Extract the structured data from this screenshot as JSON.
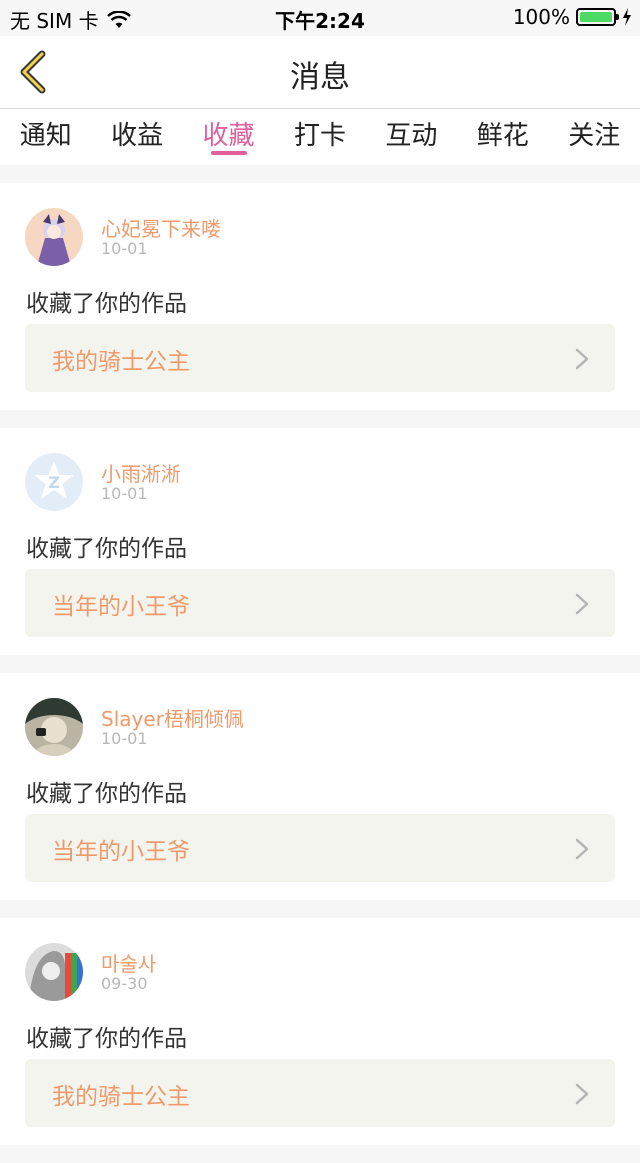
{
  "status": {
    "carrier": "无 SIM 卡",
    "time": "下午2:24",
    "battery": "100%"
  },
  "nav": {
    "title": "消息"
  },
  "tabs": [
    {
      "label": "通知"
    },
    {
      "label": "收益"
    },
    {
      "label": "收藏"
    },
    {
      "label": "打卡"
    },
    {
      "label": "互动"
    },
    {
      "label": "鲜花"
    },
    {
      "label": "关注"
    }
  ],
  "active_tab": "收藏",
  "items": [
    {
      "user": "心妃冕下来喽",
      "date": "10-01",
      "action": "收藏了你的作品",
      "work": "我的骑士公主"
    },
    {
      "user": "小雨淅淅",
      "date": "10-01",
      "action": "收藏了你的作品",
      "work": "当年的小王爷"
    },
    {
      "user": "Slayer梧桐倾佩",
      "date": "10-01",
      "action": "收藏了你的作品",
      "work": "当年的小王爷"
    },
    {
      "user": "마술사",
      "date": "09-30",
      "action": "收藏了你的作品",
      "work": "我的骑士公主"
    }
  ],
  "colors": {
    "accent": "#e0619a",
    "name": "#ef9a6b",
    "battery": "#4cd964"
  }
}
